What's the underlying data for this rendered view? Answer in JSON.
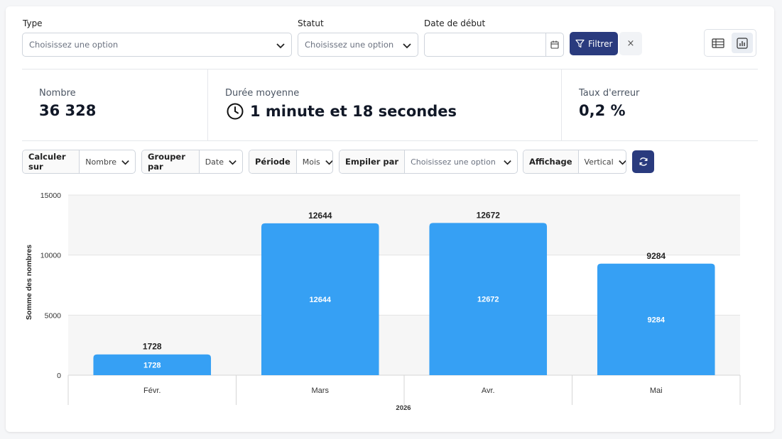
{
  "filters": {
    "type": {
      "label": "Type",
      "placeholder": "Choisissez une option"
    },
    "statut": {
      "label": "Statut",
      "placeholder": "Choisissez une option"
    },
    "date_debut": {
      "label": "Date de début",
      "value": ""
    },
    "filter_button": "Filtrer",
    "clear_button": "×"
  },
  "view_toggle": {
    "options": [
      "table-icon",
      "chart-icon"
    ],
    "active": "chart-icon"
  },
  "stats": [
    {
      "label": "Nombre",
      "value": "36 328"
    },
    {
      "label": "Durée moyenne",
      "value": "1 minute et 18 secondes",
      "icon": "clock-icon"
    },
    {
      "label": "Taux d'erreur",
      "value": "0,2 %"
    }
  ],
  "controls": {
    "calculer_sur": {
      "label": "Calculer sur",
      "value": "Nombre"
    },
    "grouper_par": {
      "label": "Grouper par",
      "value": "Date"
    },
    "periode": {
      "label": "Période",
      "value": "Mois"
    },
    "empiler_par": {
      "label": "Empiler par",
      "placeholder": "Choisissez une option"
    },
    "affichage": {
      "label": "Affichage",
      "value": "Vertical"
    }
  },
  "chart_data": {
    "type": "bar",
    "categories": [
      "Févr.",
      "Mars",
      "Avr.",
      "Mai"
    ],
    "values": [
      1728,
      12644,
      12672,
      9284
    ],
    "title": "",
    "xlabel": "2026",
    "ylabel": "Somme des nombres",
    "ylim": [
      0,
      15000
    ],
    "yticks": [
      0,
      5000,
      10000,
      15000
    ],
    "bar_color": "#36a0f4",
    "data_labels_above": true,
    "data_labels_inside": true,
    "grid": true
  },
  "colors": {
    "primary": "#2a3b7e",
    "bar": "#36a0f4"
  }
}
